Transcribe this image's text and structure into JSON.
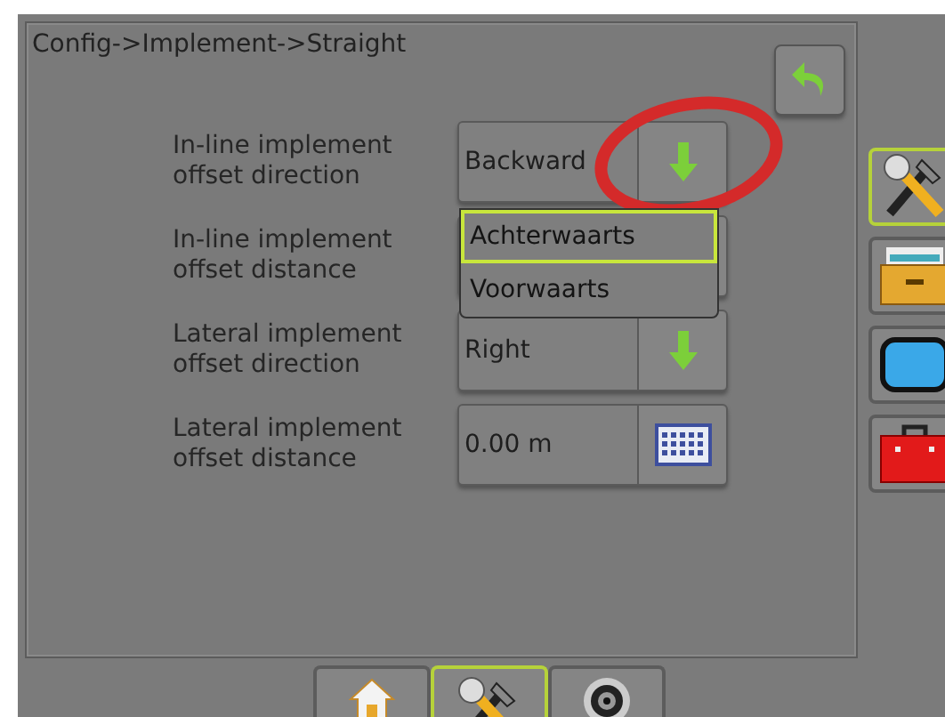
{
  "title": "Config->Implement->Straight",
  "rows": [
    {
      "label": "In-line implement offset direction",
      "value": "Backward",
      "kind": "dropdown",
      "options": [
        {
          "label": "Achterwaarts",
          "selected": true
        },
        {
          "label": "Voorwaarts",
          "selected": false
        }
      ]
    },
    {
      "label": "In-line implement offset distance",
      "kind": "covered"
    },
    {
      "label": "Lateral implement offset direction",
      "value": "Right",
      "kind": "dropdown"
    },
    {
      "label": "Lateral implement offset distance",
      "value": "0.00 m",
      "kind": "keyboard"
    }
  ],
  "sidebar": [
    {
      "kind": "tools",
      "selected": true
    },
    {
      "kind": "drawer",
      "selected": false
    },
    {
      "kind": "screen",
      "selected": false
    },
    {
      "kind": "toolbox",
      "selected": false
    }
  ],
  "bottom_tabs": [
    {
      "kind": "home",
      "selected": false
    },
    {
      "kind": "tools",
      "selected": true
    },
    {
      "kind": "camera",
      "selected": false
    }
  ],
  "annotation": {
    "kind": "ellipse",
    "color": "#d42a2a"
  }
}
